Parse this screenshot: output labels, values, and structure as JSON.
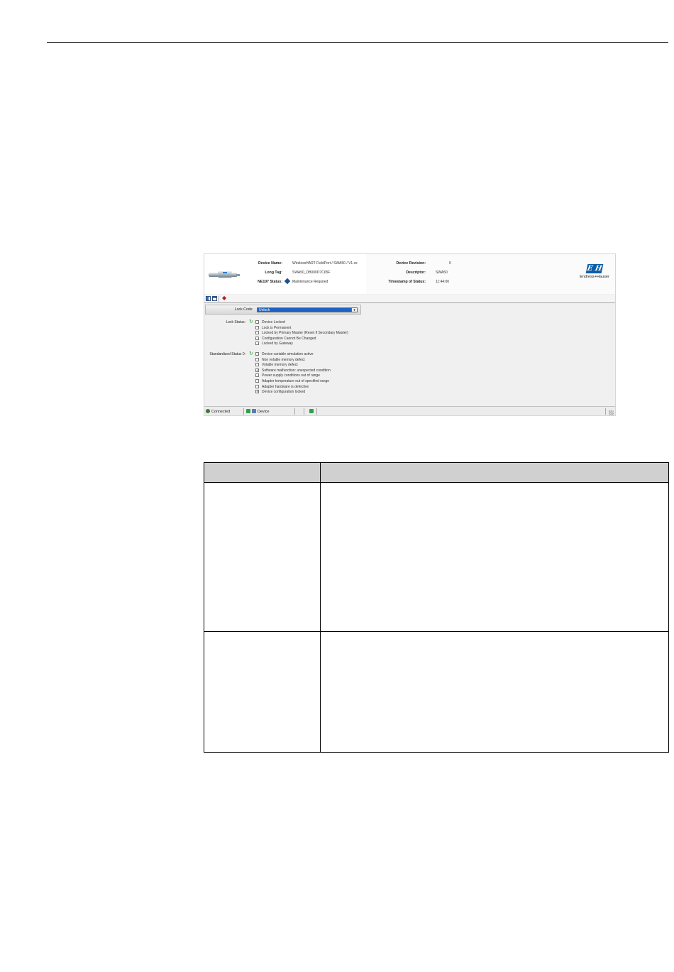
{
  "header": {
    "device_name_label": "Device Name:",
    "device_name_value": "WirelessHART FieldPort / SWA50 / V1.xx",
    "long_tag_label": "Long Tag:",
    "long_tag_value": "SWA50_DB000D7C65F",
    "ne107_label": "NE107 Status:",
    "ne107_value": "Maintenance Required",
    "device_revision_label": "Device Revision:",
    "device_revision_value": "0",
    "descriptor_label": "Descriptor:",
    "descriptor_value": "SWA50",
    "timestamp_label": "Timestamp of Status:",
    "timestamp_value": "11:44:00",
    "brand_name": "Endress+Hauser",
    "brand_mark": "E H"
  },
  "lock_code": {
    "label": "Lock Code:",
    "selected": "Unlock"
  },
  "lock_status": {
    "label": "Lock Status:",
    "items": [
      {
        "text": "Device Locked",
        "mark": ""
      },
      {
        "text": "Lock is Permanent",
        "mark": ""
      },
      {
        "text": "Locked by Primary Master (Reset if Secondary Master)",
        "mark": ""
      },
      {
        "text": "Configuration Cannot Be Changed",
        "mark": ""
      },
      {
        "text": "Locked by Gateway",
        "mark": ""
      }
    ]
  },
  "standardized_status": {
    "label": "Standardized Status 0:",
    "items": [
      {
        "text": "Device variable simulation active",
        "mark": ""
      },
      {
        "text": "Non volatile memory defect",
        "mark": ""
      },
      {
        "text": "Volatile memory defect",
        "mark": ""
      },
      {
        "text": "Software malfunction: unexpected condition",
        "mark": "✓"
      },
      {
        "text": "Power supply conditions out of range",
        "mark": ""
      },
      {
        "text": "Adapter temperature out of specified range",
        "mark": ""
      },
      {
        "text": "Adapter hardware is defective",
        "mark": ""
      },
      {
        "text": "Device configuration locked",
        "mark": "✓"
      }
    ]
  },
  "statusbar": {
    "connection": "Connected",
    "device": "Device"
  },
  "colors": {
    "accent": "#1e63c4",
    "brand": "#0a5ea8",
    "table_header": "#d0d0d0"
  }
}
